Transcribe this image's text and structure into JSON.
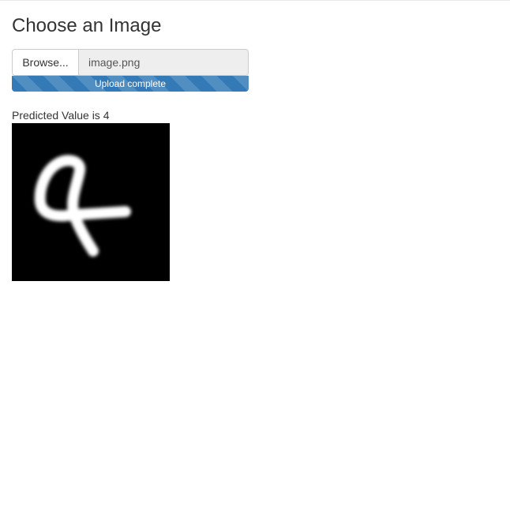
{
  "header": {
    "title": "Choose an Image"
  },
  "upload": {
    "browse_label": "Browse...",
    "file_name": "image.png",
    "progress_label": "Upload complete",
    "progress_percent": 100,
    "progress_color": "#337ab7"
  },
  "result": {
    "prediction_text": "Predicted Value is 4",
    "image_background": "#000000",
    "stroke_color": "#ffffff"
  }
}
